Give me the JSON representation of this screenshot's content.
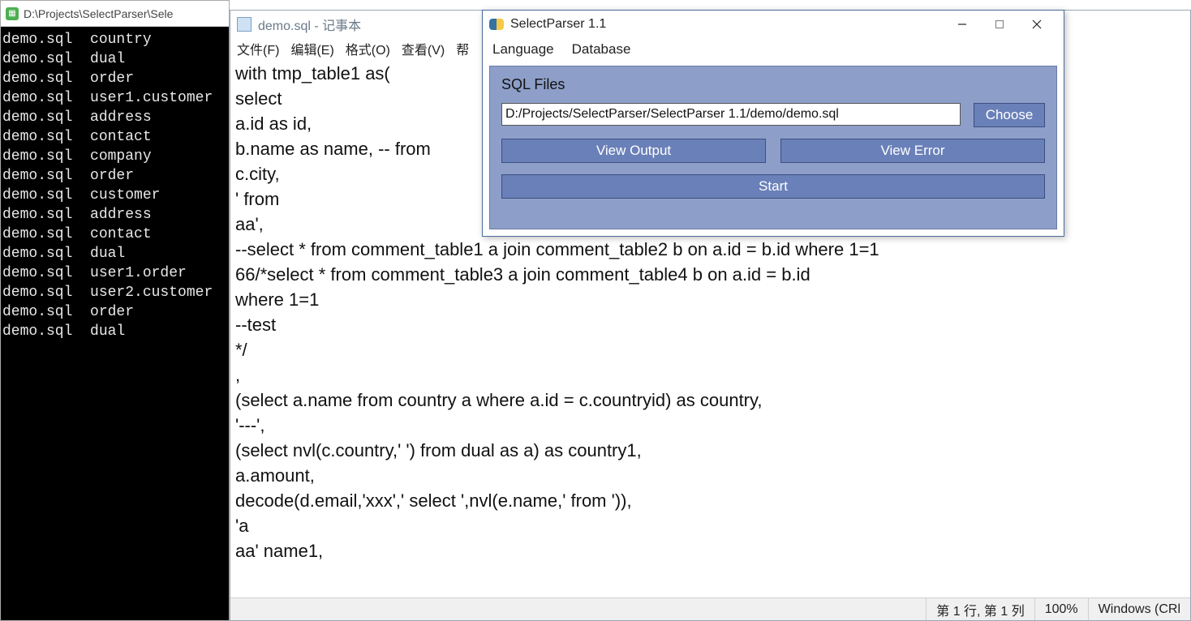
{
  "terminal": {
    "title": "D:\\Projects\\SelectParser\\Sele",
    "lines": [
      "demo.sql  country",
      "demo.sql  dual",
      "demo.sql  order",
      "demo.sql  user1.customer",
      "demo.sql  address",
      "demo.sql  contact",
      "demo.sql  company",
      "demo.sql  order",
      "demo.sql  customer",
      "demo.sql  address",
      "demo.sql  contact",
      "demo.sql  dual",
      "demo.sql  user1.order",
      "demo.sql  user2.customer",
      "demo.sql  order",
      "demo.sql  dual"
    ]
  },
  "notepad": {
    "title": "demo.sql - 记事本",
    "menu": {
      "file": "文件(F)",
      "edit": "编辑(E)",
      "format": "格式(O)",
      "view": "查看(V)",
      "help_cut": "帮"
    },
    "content": "with tmp_table1 as(\nselect\na.id as id,\nb.name as name, -- from\nc.city,\n' from\naa',\n--select * from comment_table1 a join comment_table2 b on a.id = b.id where 1=1\n66/*select * from comment_table3 a join comment_table4 b on a.id = b.id\nwhere 1=1\n--test\n*/\n,\n(select a.name from country a where a.id = c.countryid) as country,\n'---',\n(select nvl(c.country,' ') from dual as a) as country1,\na.amount,\ndecode(d.email,'xxx',' select ',nvl(e.name,' from ')),\n'a\naa' name1,",
    "status": {
      "position": "第 1 行, 第 1 列",
      "zoom": "100%",
      "encoding": "Windows (CRl"
    }
  },
  "parser": {
    "title": "SelectParser 1.1",
    "menu": {
      "language": "Language",
      "database": "Database"
    },
    "section_label": "SQL Files",
    "path": "D:/Projects/SelectParser/SelectParser 1.1/demo/demo.sql",
    "buttons": {
      "choose": "Choose",
      "view_output": "View Output",
      "view_error": "View Error",
      "start": "Start"
    }
  }
}
